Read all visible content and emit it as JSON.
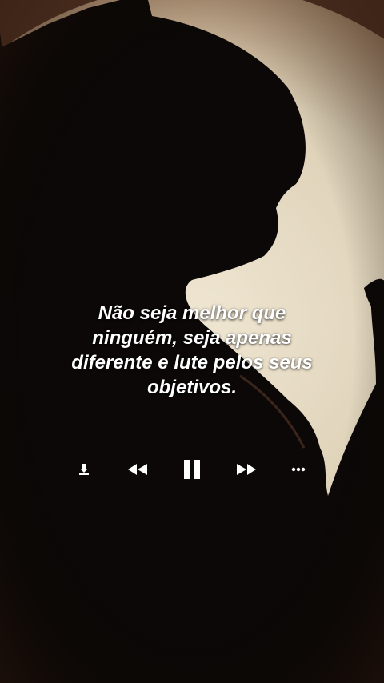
{
  "quote": {
    "text": "Não seja melhor que ninguém, seja apenas diferente e lute pelos seus objetivos."
  },
  "player": {
    "icons": [
      "download-icon",
      "rewind-icon",
      "pause-icon",
      "fast-forward-icon",
      "more-icon"
    ],
    "state": "playing"
  },
  "colors": {
    "text": "#ffffff",
    "moon": "#e8dcc4",
    "silhouette": "#0b0807",
    "warm_background": "#3a241a"
  }
}
